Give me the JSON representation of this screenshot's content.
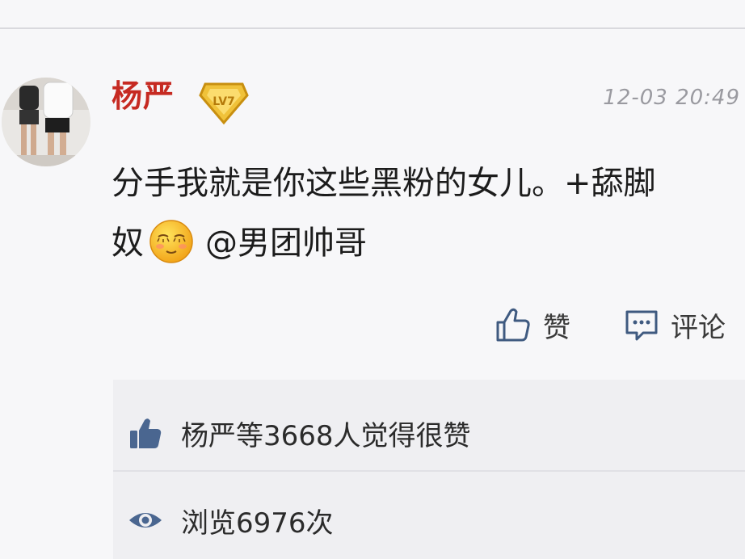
{
  "post": {
    "username": "杨严",
    "timestamp": "12-03 20:49",
    "content_line1": "分手我就是你这些黑粉的女儿。+舔脚",
    "content_line2_prefix": "奴",
    "mention": "@男团帅哥",
    "emoji": "shy-smile-emoji"
  },
  "actions": {
    "like_label": "赞",
    "comment_label": "评论"
  },
  "stats": {
    "likes_text": "杨严等3668人觉得很赞",
    "views_text": "浏览6976次"
  },
  "colors": {
    "username": "#c62a22",
    "badge_gold": "#e9b52a",
    "background": "#f7f7f9",
    "panel": "#efeff2"
  }
}
